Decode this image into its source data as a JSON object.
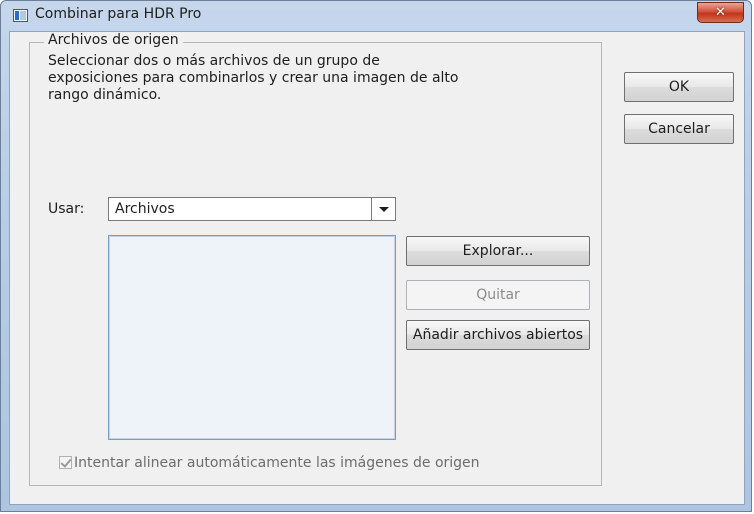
{
  "window": {
    "title": "Combinar para HDR Pro",
    "close_glyph": "✕"
  },
  "source_group": {
    "legend": "Archivos de origen",
    "description": "Seleccionar dos o más archivos de un grupo de\nexposiciones para combinarlos y crear una imagen de alto\nrango dinámico.",
    "use_label": "Usar:",
    "use_value": "Archivos",
    "file_list": []
  },
  "buttons": {
    "ok": "OK",
    "cancel": "Cancelar",
    "browse": "Explorar...",
    "remove": "Quitar",
    "add_open": "Añadir archivos abiertos"
  },
  "auto_align": {
    "label": "Intentar alinear automáticamente las imágenes de origen",
    "checked": true,
    "enabled": false
  }
}
